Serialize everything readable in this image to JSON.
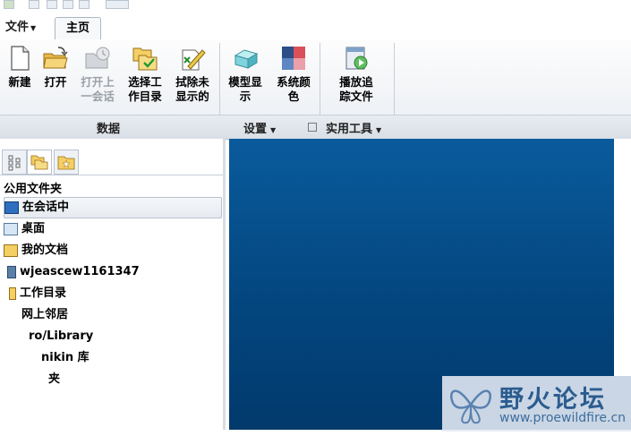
{
  "menu": {
    "file_label": "文件",
    "home_tab": "主页"
  },
  "ribbon": {
    "buttons": [
      {
        "label1": "新建",
        "label2": ""
      },
      {
        "label1": "打开",
        "label2": ""
      },
      {
        "label1": "打开上",
        "label2": "一会话"
      },
      {
        "label1": "选择工",
        "label2": "作目录"
      },
      {
        "label1": "拭除未",
        "label2": "显示的"
      },
      {
        "label1": "模型显",
        "label2": "示"
      },
      {
        "label1": "系统颜",
        "label2": "色"
      },
      {
        "label1": "播放追",
        "label2": "踪文件"
      }
    ],
    "groups": {
      "data": "数据",
      "settings": "设置",
      "tools": "实用工具"
    }
  },
  "navigator": {
    "title": "公用文件夹",
    "items": [
      "在会话中",
      "桌面",
      "我的文档",
      "wjeascew1161347",
      "工作目录",
      "网上邻居",
      "ro/Library",
      "nikin 库",
      "夹"
    ]
  },
  "watermark": {
    "cn": "野火论坛",
    "url": "www.proewildfire.cn"
  },
  "colors": {
    "graphics_bg": "#03467f",
    "accent": "#2b5c8f"
  }
}
